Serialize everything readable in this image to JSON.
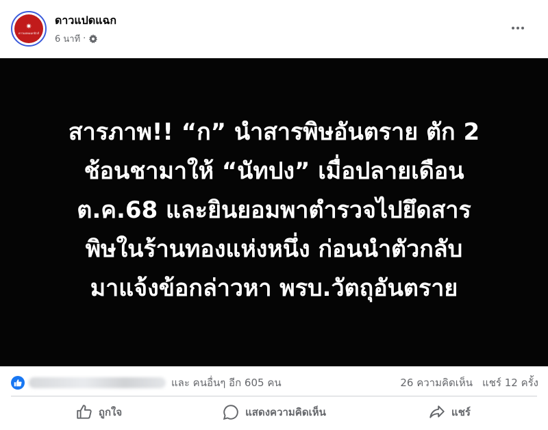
{
  "post": {
    "page_name": "ดาวแปดแฉก",
    "time": "6 นาที",
    "separator": "·",
    "avatar_text": "ดาวแปดแฉกนิวส์",
    "image_text": "สารภาพ!! “ก” นำสารพิษอันตราย ตัก 2\nช้อนชามาให้ “นัทปง” เมื่อปลายเดือน\nต.ค.68 และยินยอมพาตำรวจไปยึดสาร\nพิษในร้านทองแห่งหนึ่ง ก่อนนำตัวกลับ\nมาแจ้งข้อกล่าวหา พรบ.วัตถุอันตราย"
  },
  "stats": {
    "reactors": "และ คนอื่นๆ อีก 605 คน",
    "comments": "26 ความคิดเห็น",
    "shares": "แชร์ 12 ครั้ง"
  },
  "actions": {
    "like": "ถูกใจ",
    "comment": "แสดงความคิดเห็น",
    "share": "แชร์"
  },
  "colors": {
    "accent": "#1877f2",
    "avatar_bg": "#c11b1b",
    "image_bg": "#050505",
    "muted_text": "#65676b"
  },
  "icons": {
    "privacy": "gear-icon",
    "more": "more-horizontal-icon",
    "reaction": "like-reaction-icon",
    "like": "thumbs-up-icon",
    "comment": "comment-bubble-icon",
    "share": "share-arrow-icon"
  }
}
